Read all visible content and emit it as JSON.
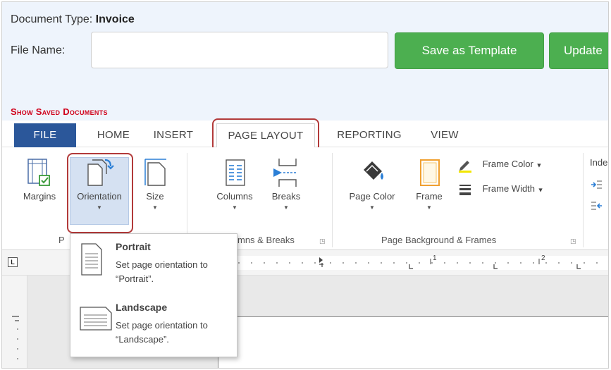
{
  "form": {
    "doc_type_label": "Document Type:",
    "doc_type_value": "Invoice",
    "file_name_label": "File Name:",
    "file_name_value": "",
    "save_template_label": "Save as Template",
    "update_label": "Update",
    "show_saved_label": "Show Saved Documents",
    "button_color": "#4caf50",
    "link_color": "#d0021b"
  },
  "tabs": [
    "FILE",
    "HOME",
    "INSERT",
    "PAGE LAYOUT",
    "REPORTING",
    "VIEW"
  ],
  "ribbon": {
    "page_setup": {
      "margins": "Margins",
      "orientation": "Orientation",
      "size": "Size",
      "group_label_fragment": "P"
    },
    "columns_breaks": {
      "columns": "Columns",
      "breaks": "Breaks",
      "group_label": "mns & Breaks"
    },
    "background": {
      "page_color": "Page Color",
      "frame": "Frame",
      "frame_color": "Frame Color",
      "frame_width": "Frame Width",
      "group_label": "Page Background & Frames"
    },
    "indent_fragment": "Inde"
  },
  "ruler": {
    "corner_label": "L",
    "marks": [
      "1",
      "2"
    ]
  },
  "orientation_menu": [
    {
      "title": "Portrait",
      "description": "Set page orientation to “Portrait”."
    },
    {
      "title": "Landscape",
      "description": "Set page orientation to “Landscape”."
    }
  ],
  "colors": {
    "file_tab": "#2b579a",
    "highlight_box": "#b23a3a",
    "active_button": "#d5e1f2"
  }
}
